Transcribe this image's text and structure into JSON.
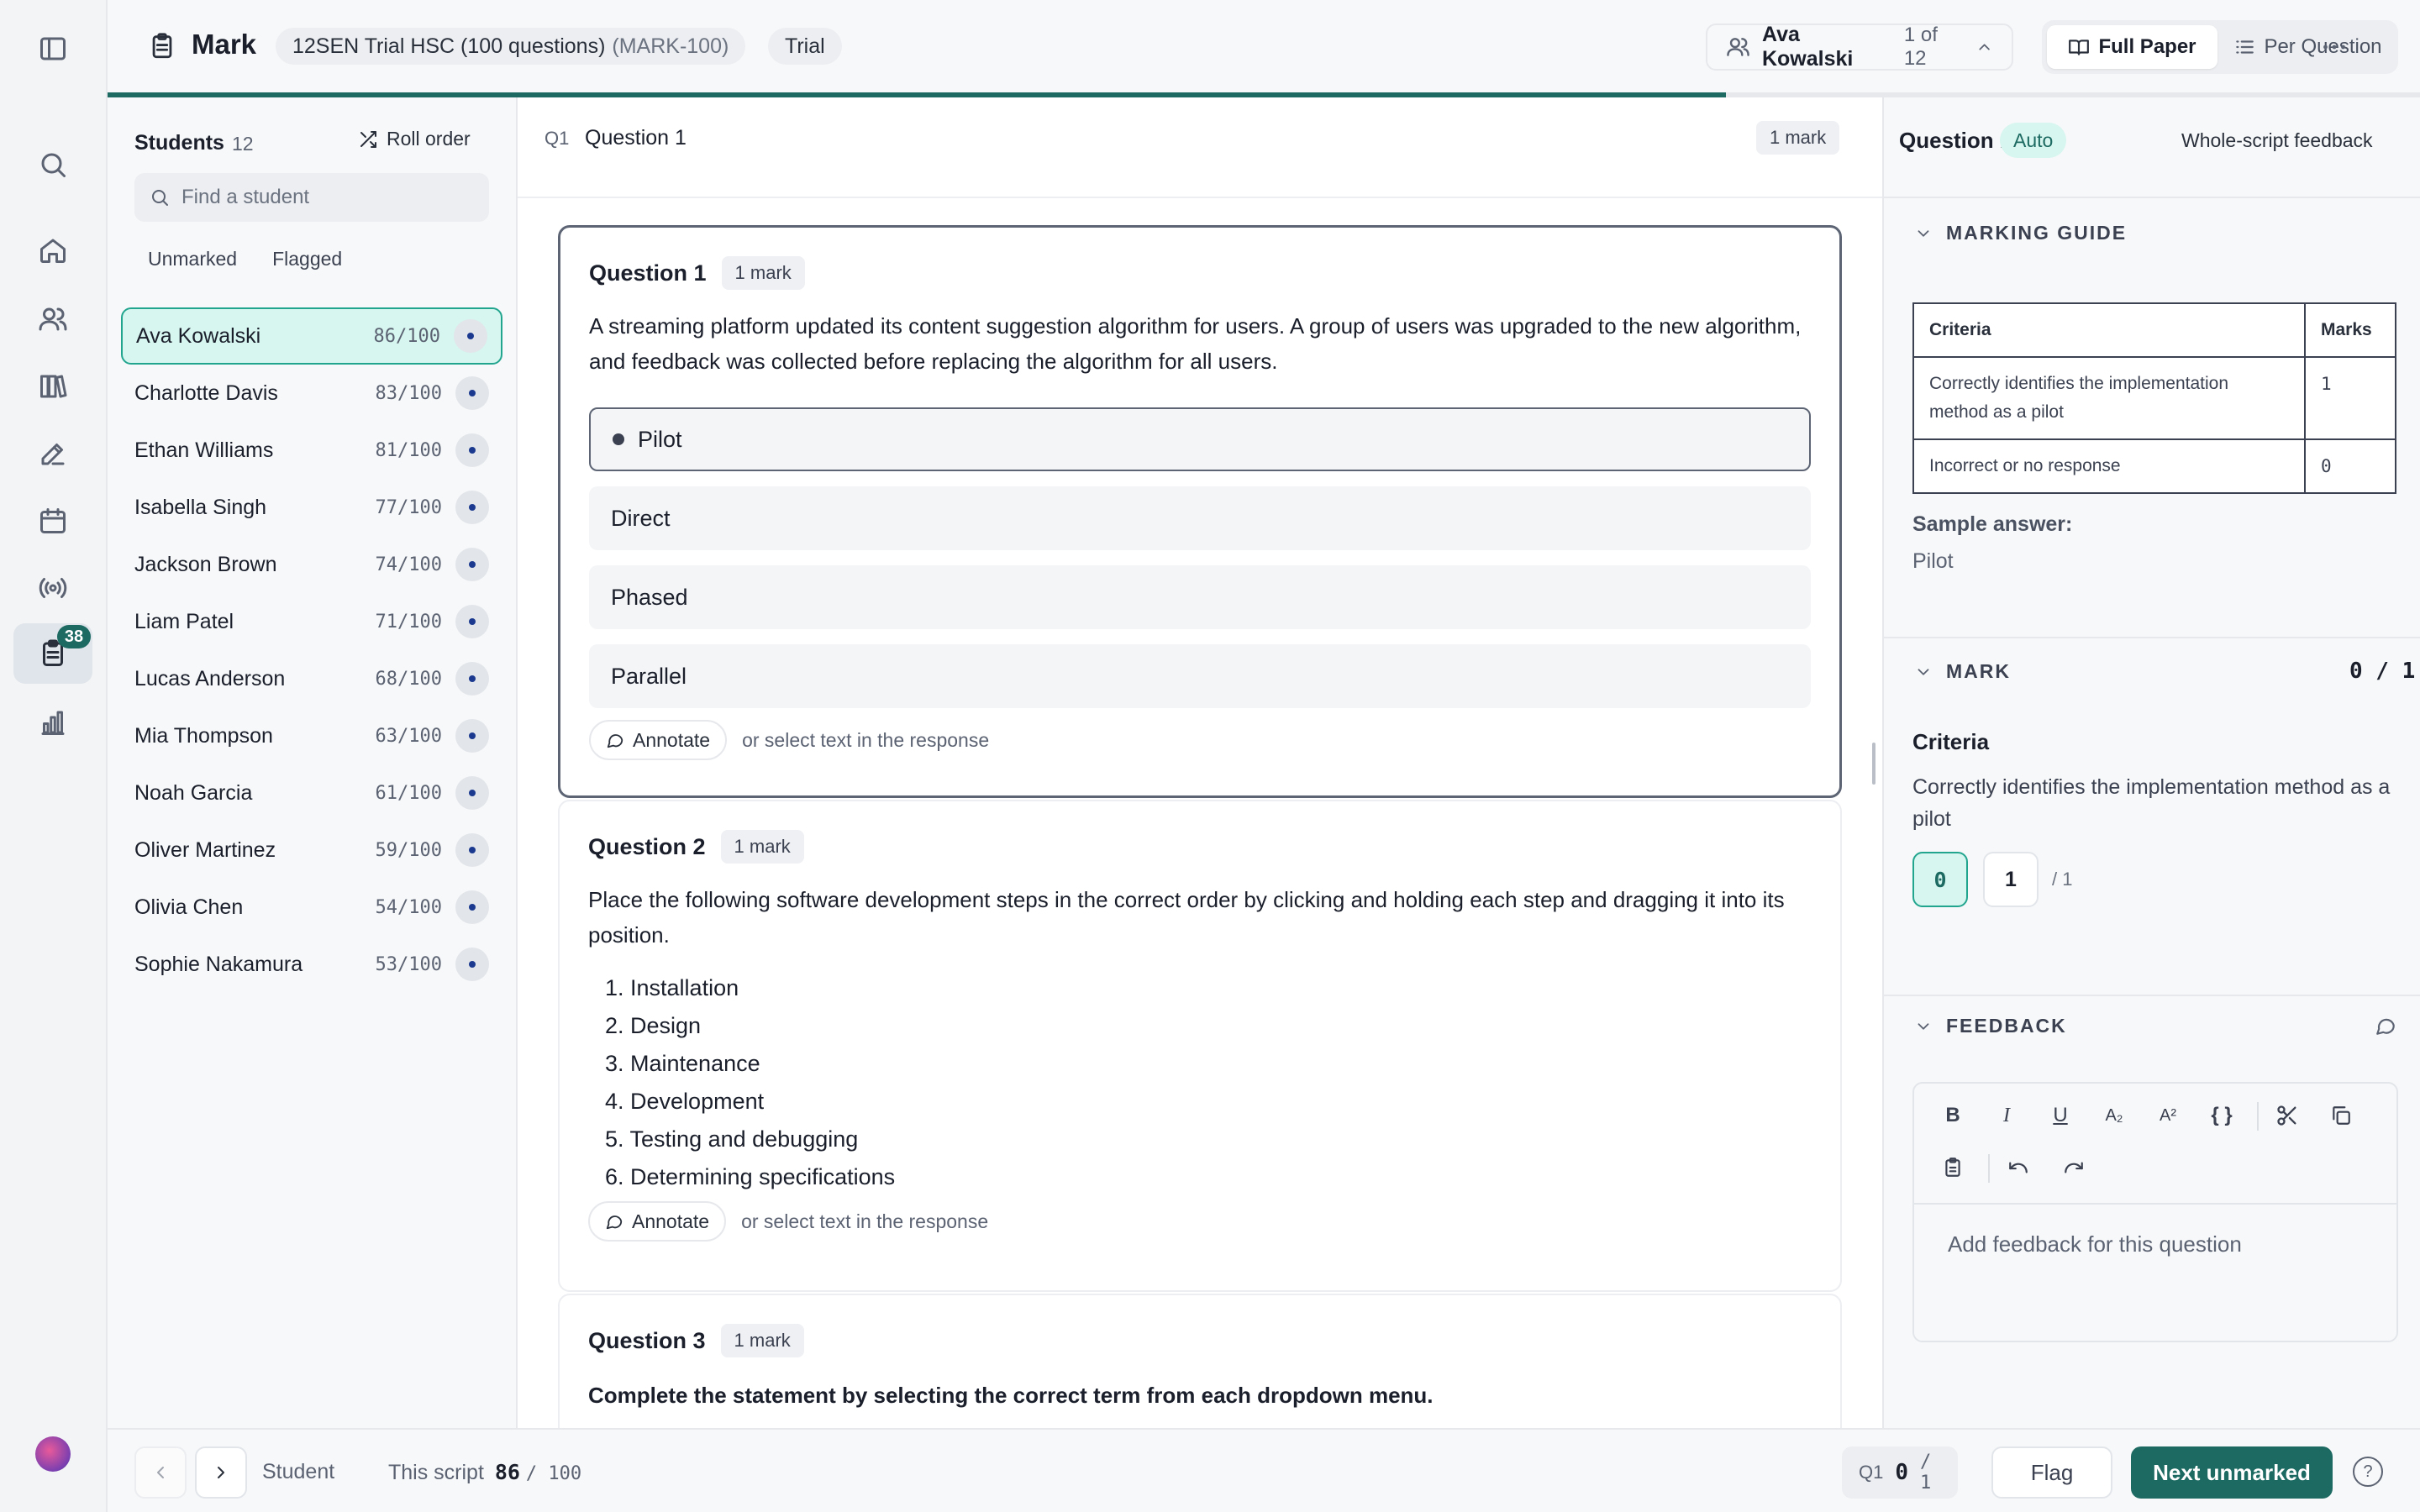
{
  "header": {
    "title": "Mark",
    "exam_name": "12SEN Trial HSC (100 questions)",
    "exam_code": "(MARK-100)",
    "exam_type": "Trial",
    "current_student": "Ava Kowalski",
    "student_position": "1 of 12",
    "view_full": "Full Paper",
    "view_per_question": "Per Question",
    "progress_percent": 70
  },
  "rail": {
    "badge_count": "38",
    "icons": [
      "sidebar-toggle-icon",
      "search-icon",
      "home-icon",
      "users-icon",
      "library-icon",
      "pencil-icon",
      "calendar-icon",
      "broadcast-icon",
      "clipboard-icon",
      "chart-icon"
    ]
  },
  "students": {
    "title": "Students",
    "count": "12",
    "roll_order": "Roll order",
    "search_placeholder": "Find a student",
    "filter_unmarked": "Unmarked",
    "filter_flagged": "Flagged",
    "list": [
      {
        "name": "Ava Kowalski",
        "score": "86/100"
      },
      {
        "name": "Charlotte Davis",
        "score": "83/100"
      },
      {
        "name": "Ethan Williams",
        "score": "81/100"
      },
      {
        "name": "Isabella Singh",
        "score": "77/100"
      },
      {
        "name": "Jackson Brown",
        "score": "74/100"
      },
      {
        "name": "Liam Patel",
        "score": "71/100"
      },
      {
        "name": "Lucas Anderson",
        "score": "68/100"
      },
      {
        "name": "Mia Thompson",
        "score": "63/100"
      },
      {
        "name": "Noah Garcia",
        "score": "61/100"
      },
      {
        "name": "Oliver Martinez",
        "score": "59/100"
      },
      {
        "name": "Olivia Chen",
        "score": "54/100"
      },
      {
        "name": "Sophie Nakamura",
        "score": "53/100"
      }
    ]
  },
  "main": {
    "q_tag": "Q1",
    "q_label": "Question 1",
    "q_marks": "1 mark",
    "annotate_label": "Annotate",
    "annotate_hint": "or select text in the response",
    "q1": {
      "title": "Question 1",
      "marks": "1 mark",
      "text": "A streaming platform updated its content suggestion algorithm for users. A group of users was upgraded to the new algorithm, and feedback was collected before replacing the algorithm for all users.",
      "options": [
        "Pilot",
        "Direct",
        "Phased",
        "Parallel"
      ]
    },
    "q2": {
      "title": "Question 2",
      "marks": "1 mark",
      "text": "Place the following software development steps in the correct order by clicking and holding each step and dragging it into its position.",
      "items": [
        "1. Installation",
        "2. Design",
        "3. Maintenance",
        "4. Development",
        "5. Testing and debugging",
        "6. Determining specifications"
      ]
    },
    "q3": {
      "title": "Question 3",
      "marks": "1 mark",
      "text": "Complete the statement by selecting the correct term from each dropdown menu."
    }
  },
  "right": {
    "question": "Question 1",
    "auto": "Auto",
    "whole_script": "Whole-script feedback",
    "marking_guide": "MARKING GUIDE",
    "table_headers": [
      "Criteria",
      "Marks"
    ],
    "table_rows": [
      {
        "criteria": "Correctly identifies the implementation method as a pilot",
        "marks": "1"
      },
      {
        "criteria": "Incorrect or no response",
        "marks": "0"
      }
    ],
    "sample_label": "Sample answer:",
    "sample_value": "Pilot",
    "mark_section": "MARK",
    "mark_value": "0 / 1",
    "criteria_label": "Criteria",
    "criteria_text": "Correctly identifies the implementation method as a pilot",
    "mark_options": [
      "0",
      "1"
    ],
    "mark_out_of": "/ 1",
    "feedback_section": "FEEDBACK",
    "feedback_placeholder": "Add feedback for this question",
    "toolbar": {
      "bold": "B",
      "italic": "I",
      "underline": "U",
      "subscript": "A₂",
      "superscript": "A²",
      "code": "{ }"
    }
  },
  "footer": {
    "student_label": "Student",
    "script_label": "This script",
    "script_score": "86",
    "script_total": "/ 100",
    "q_tag": "Q1",
    "q_score": "0",
    "q_total": "/ 1",
    "flag": "Flag",
    "next_unmarked": "Next unmarked",
    "help": "?"
  },
  "colors": {
    "accent": "#1d6a62",
    "accent_light": "#d6f6ef",
    "accent_border": "#22a58f"
  }
}
